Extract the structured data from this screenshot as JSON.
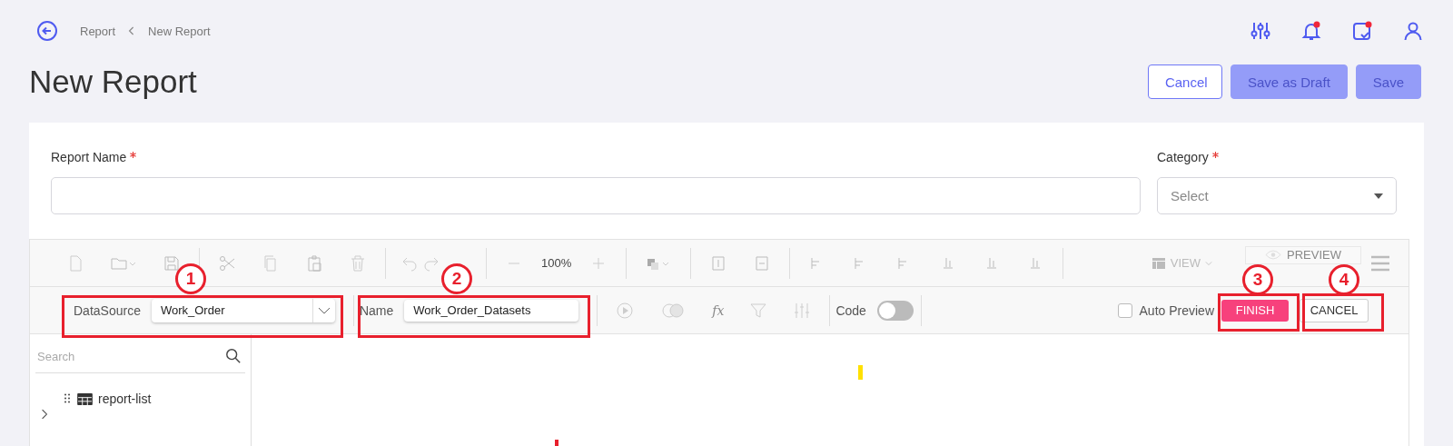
{
  "breadcrumb": [
    {
      "label": "Report"
    },
    {
      "label": "New Report"
    }
  ],
  "page_title": "New Report",
  "actions": [
    {
      "label": "Cancel",
      "kind": "outline",
      "disabled": false
    },
    {
      "label": "Save as Draft",
      "kind": "primary",
      "disabled": true
    },
    {
      "label": "Save",
      "kind": "primary",
      "disabled": true
    }
  ],
  "form": {
    "fields": [
      {
        "label": "Report Name",
        "required": true,
        "kind": "text"
      },
      {
        "label": "Category",
        "required": true,
        "kind": "select",
        "placeholder": "Select"
      }
    ]
  },
  "toolbar": {
    "zoom": "100%",
    "view": "VIEW",
    "preview": "PREVIEW"
  },
  "dataset_bar": {
    "datasource_label": "DataSource",
    "datasource": "Work_Order",
    "name_label": "Name",
    "name": "Work_Order_Datasets",
    "fx": "fx",
    "code_label": "Code",
    "code_on": false,
    "auto_preview": {
      "label": "Auto Preview",
      "checked": false
    },
    "finish": "FINISH",
    "cancel": "CANCEL"
  },
  "fields_panel": {
    "search_placeholder": "Search",
    "items": [
      {
        "label": "report-list",
        "expanded": false
      }
    ]
  },
  "annotations": [
    {
      "number": "1"
    },
    {
      "number": "2"
    },
    {
      "number": "3"
    },
    {
      "number": "4"
    }
  ]
}
